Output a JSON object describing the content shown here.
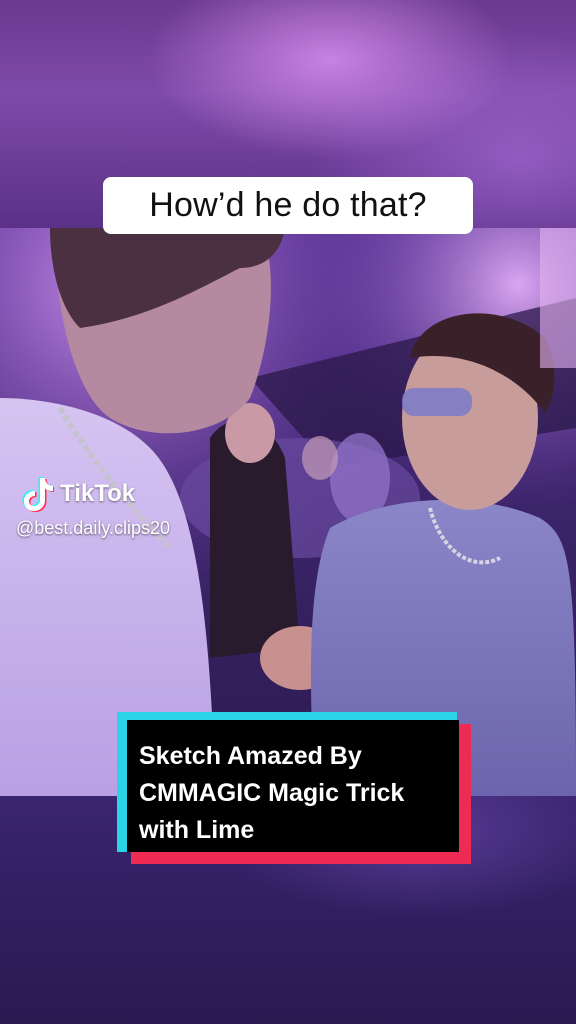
{
  "overlay": {
    "top_caption": "How’d he do that?",
    "bottom_caption": {
      "lines": [
        "Sketch Amazed By",
        "CMMAGIC Magic Trick",
        "with Lime"
      ]
    }
  },
  "watermark": {
    "brand": "TikTok",
    "handle": "@best.daily.clips20"
  },
  "colors": {
    "caption_cyan": "#2bd3e6",
    "caption_red": "#ee2b52",
    "caption_black": "#000000"
  },
  "icons": [
    "tiktok-note-icon"
  ]
}
